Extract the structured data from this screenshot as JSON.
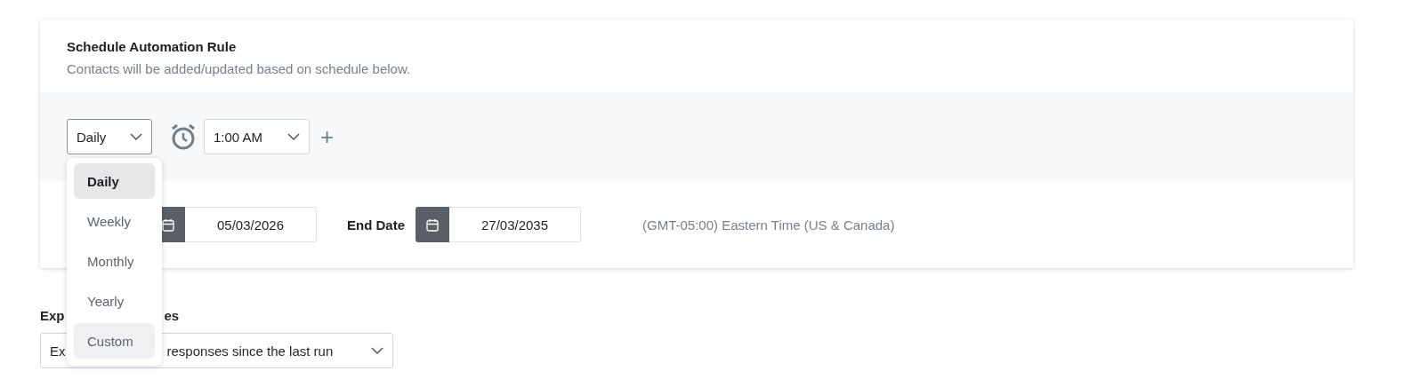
{
  "schedule_card": {
    "title": "Schedule Automation Rule",
    "subtitle": "Contacts will be added/updated based on schedule below.",
    "frequency_select": {
      "value": "Daily",
      "expanded": true
    },
    "time_select": {
      "value": "1:00 AM"
    },
    "add_time": "+",
    "start_date": {
      "value": "05/03/2026"
    },
    "end_date": {
      "label": "End Date",
      "value": "27/03/2035"
    },
    "timezone": "(GMT-05:00) Eastern Time (US & Canada)"
  },
  "export_section": {
    "label_parts": [
      "Exp",
      "es"
    ],
    "select_parts": [
      "Ex",
      "responses since the last run"
    ]
  },
  "frequency_menu": [
    {
      "label": "Daily",
      "selected": true,
      "hovered": false
    },
    {
      "label": "Weekly",
      "selected": false,
      "hovered": false
    },
    {
      "label": "Monthly",
      "selected": false,
      "hovered": false
    },
    {
      "label": "Yearly",
      "selected": false,
      "hovered": false
    },
    {
      "label": "Custom",
      "selected": false,
      "hovered": true
    }
  ]
}
